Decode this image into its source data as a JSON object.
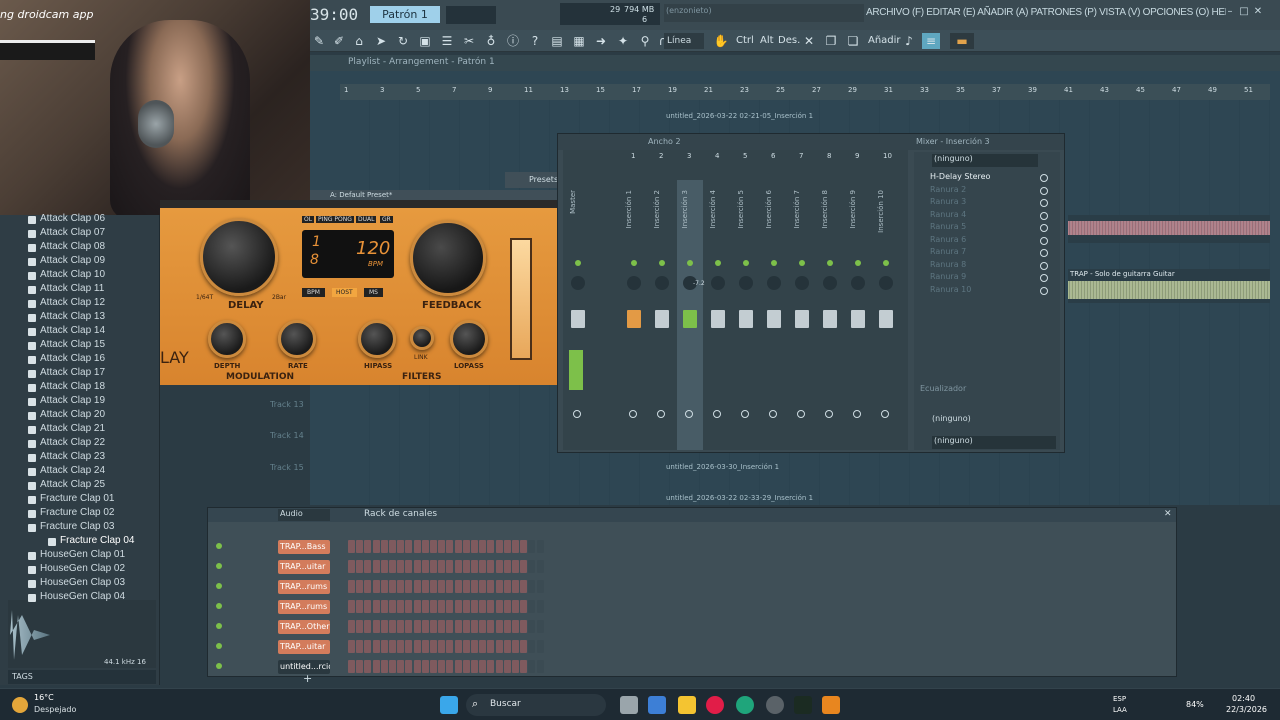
{
  "webcam": {
    "overlay_text": "ng droidcam app"
  },
  "toolbar": {
    "time": "39:00",
    "pattern": "Patrón 1",
    "cpu": "29",
    "memory": "794 MB",
    "voices": "6",
    "hint": "(enzonieto)",
    "menu": "ARCHIVO (F) EDITAR (E) AÑADIR (A) PATRONES (P) VISTA (V) OPCIONES (O) HERRAMIENTAS (T) AYUDA",
    "snap": "Línea",
    "btn_ctrl": "Ctrl",
    "btn_alt": "Alt",
    "btn_des": "Des.",
    "btn_add": "Añadir"
  },
  "playlist": {
    "title": "Playlist - Arrangement - Patrón 1",
    "ruler": [
      "1",
      "3",
      "5",
      "7",
      "9",
      "11",
      "13",
      "15",
      "17",
      "19",
      "21",
      "23",
      "25",
      "27",
      "29",
      "31",
      "33",
      "35",
      "37",
      "39",
      "41",
      "43",
      "45",
      "47",
      "49",
      "51"
    ],
    "clip1": "untitled_2026-03-22 02-21-05_Inserción 1",
    "clip2": "untitled_2026-03-30_Inserción 1",
    "clip3": "untitled_2026-03-22 02-33-29_Inserción 1",
    "clip_trap": "TRAP - Solo de guitarra Guitar",
    "tracks": [
      "Track 13",
      "Track 14",
      "Track 15"
    ]
  },
  "plugin": {
    "preset": "A: Default Preset*",
    "presets_label": "Presets",
    "setup_label": "Setup",
    "mode_buttons": [
      "OL",
      "PING PONG",
      "DUAL",
      "GR"
    ],
    "display_top": "1",
    "display_bottom": "8",
    "bpm": "120",
    "bpm_unit": "BPM",
    "sync_buttons": [
      "BPM",
      "HOST",
      "MS"
    ],
    "delay_label": "DELAY",
    "delay_min": "1/64T",
    "delay_max": "2Bar",
    "feedback_label": "FEEDBACK",
    "depth_label": "DEPTH",
    "rate_label": "RATE",
    "modulation_label": "MODULATION",
    "hipass_label": "HIPASS",
    "link_label": "LINK",
    "lopass_label": "LOPASS",
    "filters_label": "FILTERS",
    "logo": "LAY"
  },
  "mixer": {
    "title": "Ancho 2",
    "insert_title": "Mixer - Inserción 3",
    "tracks": [
      "Master",
      "Inserción 1",
      "Inserción 2",
      "Inserción 3",
      "Inserción 4",
      "Inserción 5",
      "Inserción 6",
      "Inserción 7",
      "Inserción 8",
      "Inserción 9",
      "Inserción 10"
    ],
    "numbers": [
      "",
      "1",
      "2",
      "3",
      "4",
      "5",
      "6",
      "7",
      "8",
      "9",
      "10"
    ],
    "pan_value": "-7.2",
    "effect_input": "(ninguno)",
    "slots": [
      "H-Delay Stereo",
      "Ranura 2",
      "Ranura 3",
      "Ranura 4",
      "Ranura 5",
      "Ranura 6",
      "Ranura 7",
      "Ranura 8",
      "Ranura 9",
      "Ranura 10"
    ],
    "eq_label": "Ecualizador",
    "out_1": "(ninguno)",
    "out_2": "(ninguno)"
  },
  "browser": {
    "items": [
      "Attack Clap 06",
      "Attack Clap 07",
      "Attack Clap 08",
      "Attack Clap 09",
      "Attack Clap 10",
      "Attack Clap 11",
      "Attack Clap 12",
      "Attack Clap 13",
      "Attack Clap 14",
      "Attack Clap 15",
      "Attack Clap 16",
      "Attack Clap 17",
      "Attack Clap 18",
      "Attack Clap 19",
      "Attack Clap 20",
      "Attack Clap 21",
      "Attack Clap 22",
      "Attack Clap 23",
      "Attack Clap 24",
      "Attack Clap 25",
      "Fracture Clap 01",
      "Fracture Clap 02",
      "Fracture Clap 03",
      "Fracture Clap 04",
      "HouseGen Clap 01",
      "HouseGen Clap 02",
      "HouseGen Clap 03",
      "HouseGen Clap 04"
    ],
    "selected_index": 23,
    "sample_info": "44.1 kHz 16",
    "tags_label": "TAGS"
  },
  "rack": {
    "filter": "Audio",
    "title": "Rack de canales",
    "channels": [
      "TRAP...Bass",
      "TRAP...uitar",
      "TRAP...rums",
      "TRAP...rums",
      "TRAP...Other",
      "TRAP...uitar",
      "untitled...rción 1"
    ],
    "add_label": "+"
  },
  "taskbar": {
    "weather_temp": "16°C",
    "weather_desc": "Despejado",
    "search": "Buscar",
    "lang1": "ESP",
    "lang2": "LAA",
    "battery": "84%",
    "time": "02:40",
    "date": "22/3/2026"
  },
  "colors": {
    "accent": "#d8842e",
    "mixer_selected": "#7dc04a",
    "rack_channel": "#d37c5c",
    "playlist_bg": "#2e4653"
  }
}
